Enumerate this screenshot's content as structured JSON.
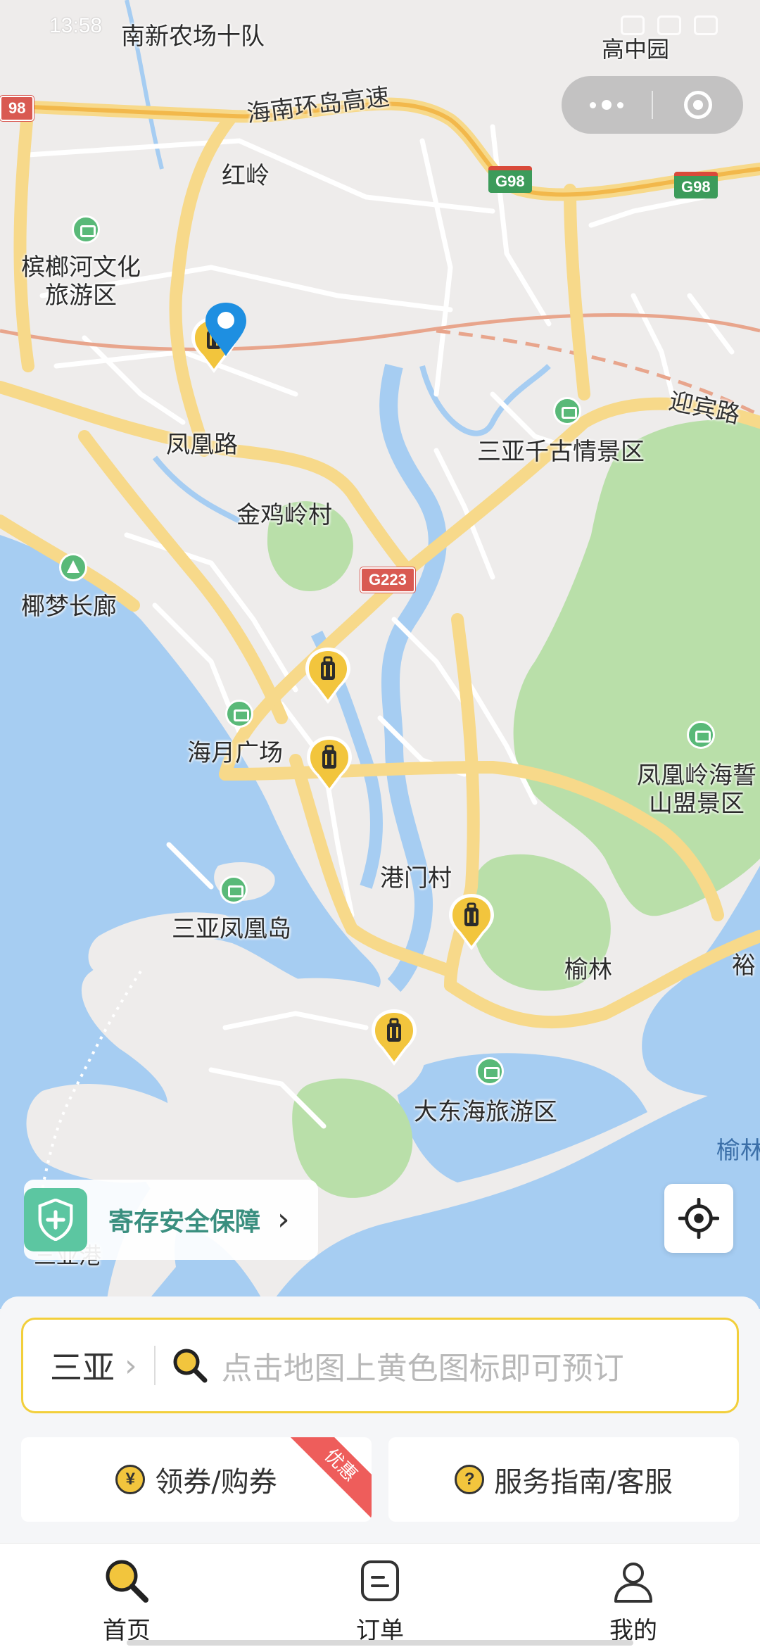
{
  "status_bar": {
    "time": "13:58"
  },
  "capsule": {
    "more_icon": "more-dots-icon",
    "close_icon": "target-close-icon"
  },
  "map": {
    "places": {
      "nanxin": "南新农场十队",
      "gaozhongyuan": "高中园",
      "hongling": "红岭",
      "binlanghe": "槟榔河文化\n旅游区",
      "fenghuang_road": "凤凰路",
      "sanya_qiangu": "三亚千古情景区",
      "yingbin_road": "迎宾路",
      "jinjilingcun": "金鸡岭村",
      "yemeng": "椰梦长廊",
      "haiyue": "海月广场",
      "fenghuangling": "凤凰岭海誓\n山盟景区",
      "gangmencun": "港门村",
      "fenghuangdao": "三亚凤凰岛",
      "yulin": "榆林",
      "yu_edge": "裕",
      "dadonghai": "大东海旅游区",
      "yulin_water": "榆林",
      "sanya_port": "三亚港"
    },
    "roads": {
      "expressway": "海南环岛高速"
    },
    "shields": {
      "g98_left": "98",
      "g98_mid": "G98",
      "g98_right": "G98",
      "g223": "G223"
    },
    "luggage_markers": 5
  },
  "safety_banner": {
    "label": "寄存安全保障",
    "arrow": "›"
  },
  "search": {
    "city": "三亚",
    "chevron": "›",
    "placeholder": "点击地图上黄色图标即可预订"
  },
  "actions": {
    "coupon": {
      "icon_char": "¥",
      "label": "领券/购券",
      "ribbon": "优惠"
    },
    "guide": {
      "icon_char": "?",
      "label": "服务指南/客服"
    }
  },
  "tabs": [
    {
      "label": "首页",
      "icon": "home-search-icon"
    },
    {
      "label": "订单",
      "icon": "order-icon"
    },
    {
      "label": "我的",
      "icon": "profile-icon"
    }
  ],
  "colors": {
    "accent": "#f2cf3b",
    "water": "#a6cdf2",
    "green": "#b9dfa9",
    "road": "#f7d98a"
  }
}
